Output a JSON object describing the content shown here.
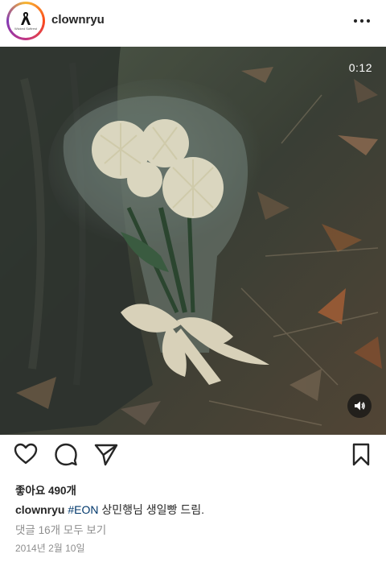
{
  "post": {
    "username": "clownryu",
    "avatar_text": "Wicked Softrest",
    "video_timer": "0:12",
    "likes_text": "좋아요 490개",
    "caption": {
      "username": "clownryu",
      "hashtag": "#EON",
      "text": "상민행님 생일빵 드림."
    },
    "comments_link": "댓글 16개 모두 보기",
    "date": "2014년 2월 10일"
  },
  "icons": {
    "more": "more-options-icon",
    "volume": "speaker-icon",
    "like": "heart-icon",
    "comment": "comment-icon",
    "share": "paper-plane-icon",
    "save": "bookmark-icon"
  }
}
